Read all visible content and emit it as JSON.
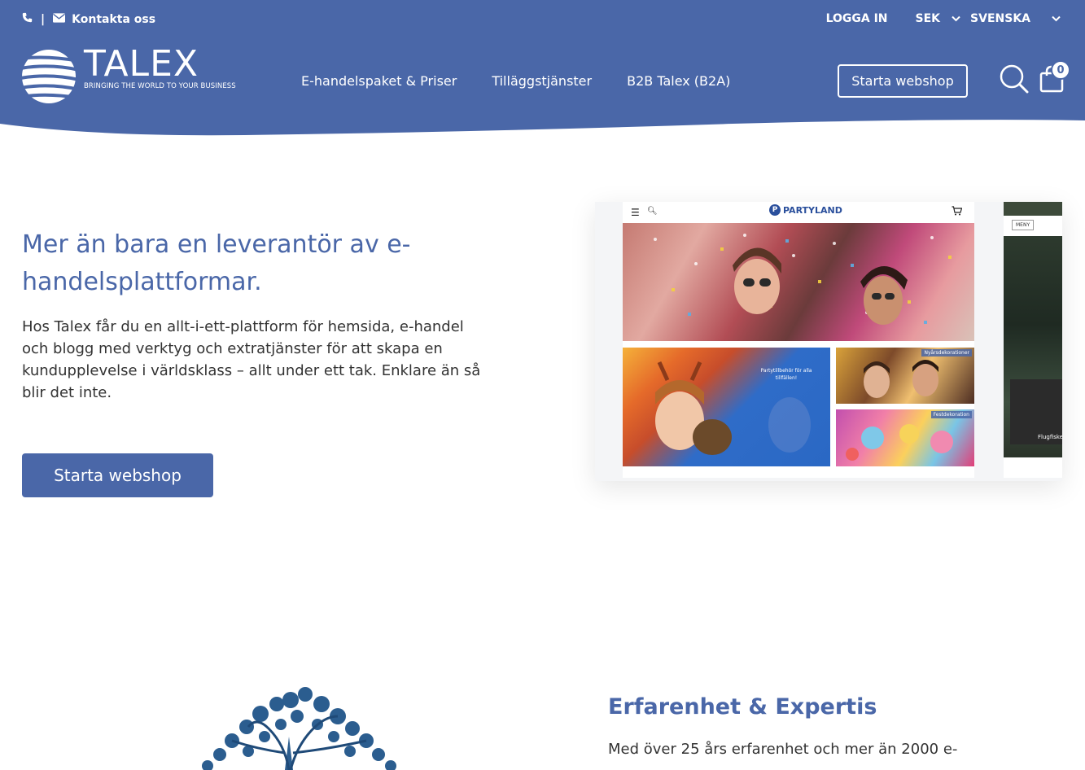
{
  "topbar": {
    "contact_label": "Kontakta oss",
    "separator": "|",
    "login_label": "LOGGA IN",
    "currency_label": "SEK",
    "language_label": "SVENSKA"
  },
  "brand": {
    "name": "TALEX",
    "tagline": "BRINGING THE WORLD TO YOUR BUSINESS",
    "color": "#4a67a8"
  },
  "nav": {
    "items": [
      {
        "label": "E-handelspaket & Priser"
      },
      {
        "label": "Tilläggstjänster"
      },
      {
        "label": "B2B Talex (B2A)"
      }
    ],
    "cta_label": "Starta webshop",
    "cart_count": "0"
  },
  "hero": {
    "title": "Mer än bara en leverantör av e-handelsplattformar.",
    "body": "Hos Talex får du en allt-i-ett-plattform för hemsida, e-handel och blogg med verktyg och extratjänster för att skapa en kundupplevelse i världsklass – allt under ett tak. Enklare än så blir det inte.",
    "button_label": "Starta webshop"
  },
  "mockup": {
    "brand": "PARTYLAND",
    "tile1_caption": "Partytillbehör för alla tillfällen!",
    "tile2_label": "Nyårsdekorationer",
    "tile3_label": "Festdekoration",
    "side_menu_label": "MENY",
    "side_caption": "Flugfiske"
  },
  "section2": {
    "title": "Erfarenhet & Expertis",
    "body": "Med över 25 års erfarenhet och mer än 2000 e-"
  }
}
